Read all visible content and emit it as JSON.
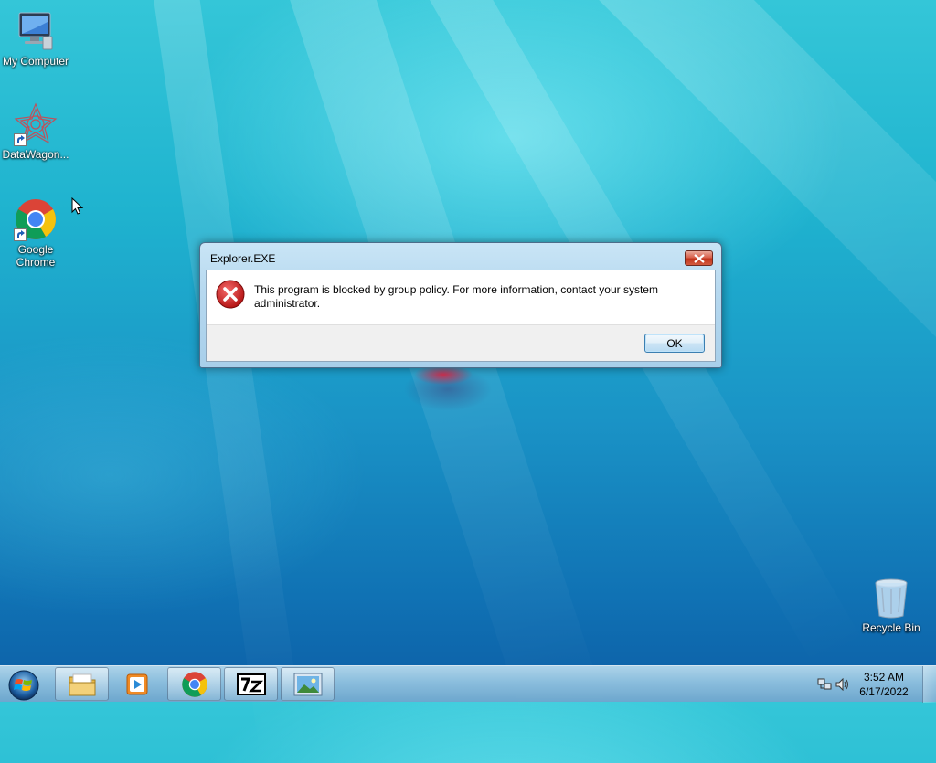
{
  "desktop": {
    "icons": [
      {
        "label": "My Computer"
      },
      {
        "label": "DataWagon..."
      },
      {
        "label": "Google Chrome"
      },
      {
        "label": "Recycle Bin"
      }
    ]
  },
  "dialog": {
    "title": "Explorer.EXE",
    "message": "This program is blocked by group policy. For more information, contact your system administrator.",
    "ok_label": "OK",
    "icon": "error-icon"
  },
  "taskbar": {
    "items": [
      {
        "name": "start-button",
        "icon": "windows-orb-icon"
      },
      {
        "name": "file-explorer",
        "icon": "folder-icon"
      },
      {
        "name": "media-player",
        "icon": "media-player-icon"
      },
      {
        "name": "google-chrome",
        "icon": "chrome-icon"
      },
      {
        "name": "7zip",
        "icon": "7zip-icon"
      },
      {
        "name": "image-viewer",
        "icon": "image-viewer-icon"
      }
    ],
    "clock": {
      "time": "3:52 AM",
      "date": "6/17/2022"
    },
    "tray_icons": [
      "network-icon",
      "volume-icon"
    ]
  },
  "colors": {
    "close_button": "#c2351d",
    "error_red": "#d51f1f",
    "ok_border": "#3c7fb1"
  }
}
